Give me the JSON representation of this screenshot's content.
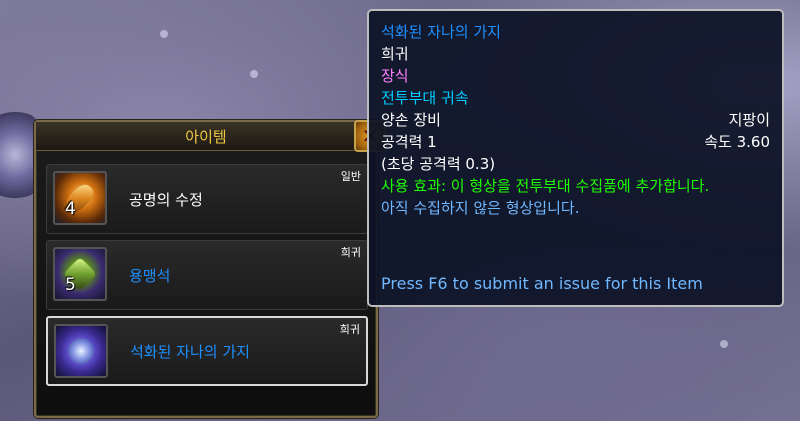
{
  "loot": {
    "title": "아이템",
    "close_glyph": "✕",
    "items": [
      {
        "name": "공명의 수정",
        "count": "4",
        "quality": "일반",
        "icon": "crystal-icon"
      },
      {
        "name": "용맹석",
        "count": "5",
        "quality": "희귀",
        "icon": "dragon-stone-icon"
      },
      {
        "name": "석화된 자나의 가지",
        "count": "",
        "quality": "희귀",
        "icon": "petrified-branch-icon"
      }
    ]
  },
  "tooltip": {
    "name": "석화된 자나의 가지",
    "quality": "희귀",
    "category": "장식",
    "binding": "전투부대 귀속",
    "slot": "양손 장비",
    "type": "지팡이",
    "damage": "공격력 1",
    "speed": "속도 3.60",
    "dps": "(초당 공격력 0.3)",
    "use_effect": "사용 효과: 이 형상을 전투부대 수집품에 추가합니다.",
    "collection_status": "아직 수집하지 않은 형상입니다.",
    "submit_hint": "Press F6 to submit an issue for this Item"
  },
  "colors": {
    "common": "#ffffff",
    "rare": "#1e90ff",
    "title_gold": "#f0c840",
    "use_effect": "#1eff00",
    "category_pink": "#ff80ff",
    "binding_cyan": "#00ccff"
  }
}
